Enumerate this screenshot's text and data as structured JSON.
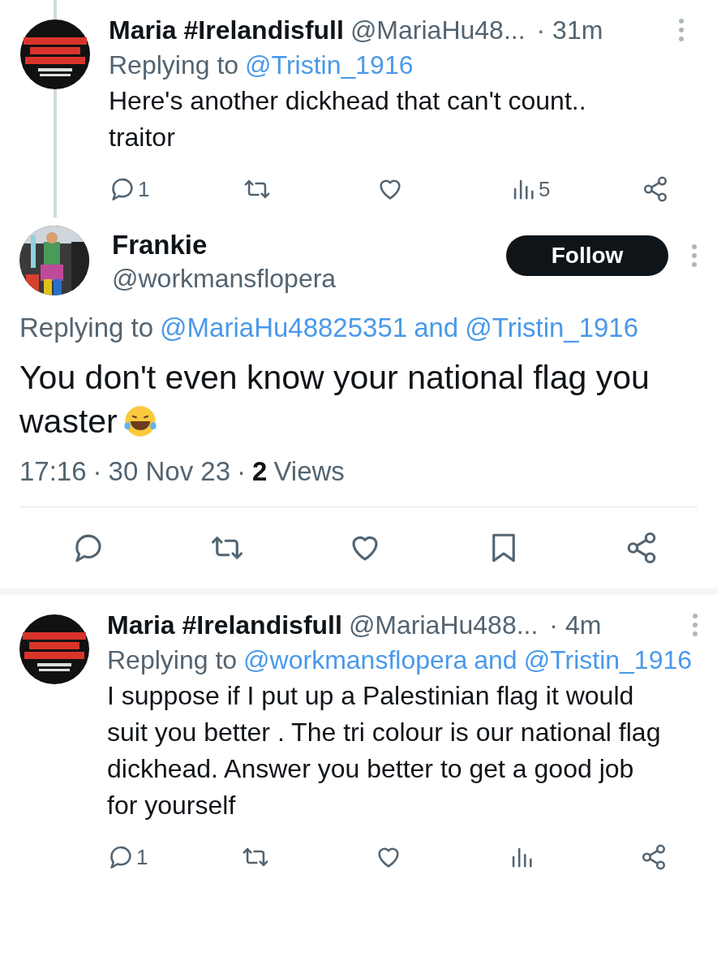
{
  "tweets": [
    {
      "kind": "reply",
      "thread_line": true,
      "author": {
        "name": "Maria #Irelandisfull",
        "handle": "@MariaHu48..."
      },
      "time": "· 31m",
      "replying_to": {
        "label": "Replying to",
        "mentions": [
          "@Tristin_1916"
        ]
      },
      "text": "Here's another dickhead that can't count..\ntraitor",
      "actions": [
        {
          "kind": "reply",
          "count": "1"
        },
        {
          "kind": "retweet"
        },
        {
          "kind": "like"
        },
        {
          "kind": "views",
          "count": "5"
        },
        {
          "kind": "share"
        }
      ]
    },
    {
      "kind": "focused",
      "author": {
        "name": "Frankie",
        "handle": "@workmansflopera"
      },
      "follow_button": "Follow",
      "replying_to": {
        "label": "Replying to",
        "mentions": [
          "@MariaHu48825351",
          "@Tristin_1916"
        ],
        "joiner": "and"
      },
      "text": "You don't even know your national flag you waster",
      "emoji": true,
      "meta": {
        "time": "17:16",
        "separator": "·",
        "date": "30 Nov 23",
        "views_count": "2",
        "views_label": "Views"
      },
      "actions": [
        {
          "kind": "reply"
        },
        {
          "kind": "retweet"
        },
        {
          "kind": "like"
        },
        {
          "kind": "bookmark"
        },
        {
          "kind": "share"
        }
      ]
    },
    {
      "kind": "reply",
      "thread_line": false,
      "author": {
        "name": "Maria #Irelandisfull",
        "handle": "@MariaHu488..."
      },
      "time": "· 4m",
      "replying_to": {
        "label": "Replying to",
        "mentions": [
          "@workmansflopera",
          "@Tristin_1916"
        ],
        "joiner": "and"
      },
      "text": "I suppose if I put up a Palestinian flag it would suit you better . The tri colour is our national flag dickhead. Answer you better to get a good job for yourself",
      "actions": [
        {
          "kind": "reply",
          "count": "1"
        },
        {
          "kind": "retweet"
        },
        {
          "kind": "like"
        },
        {
          "kind": "views"
        },
        {
          "kind": "share"
        }
      ]
    }
  ]
}
